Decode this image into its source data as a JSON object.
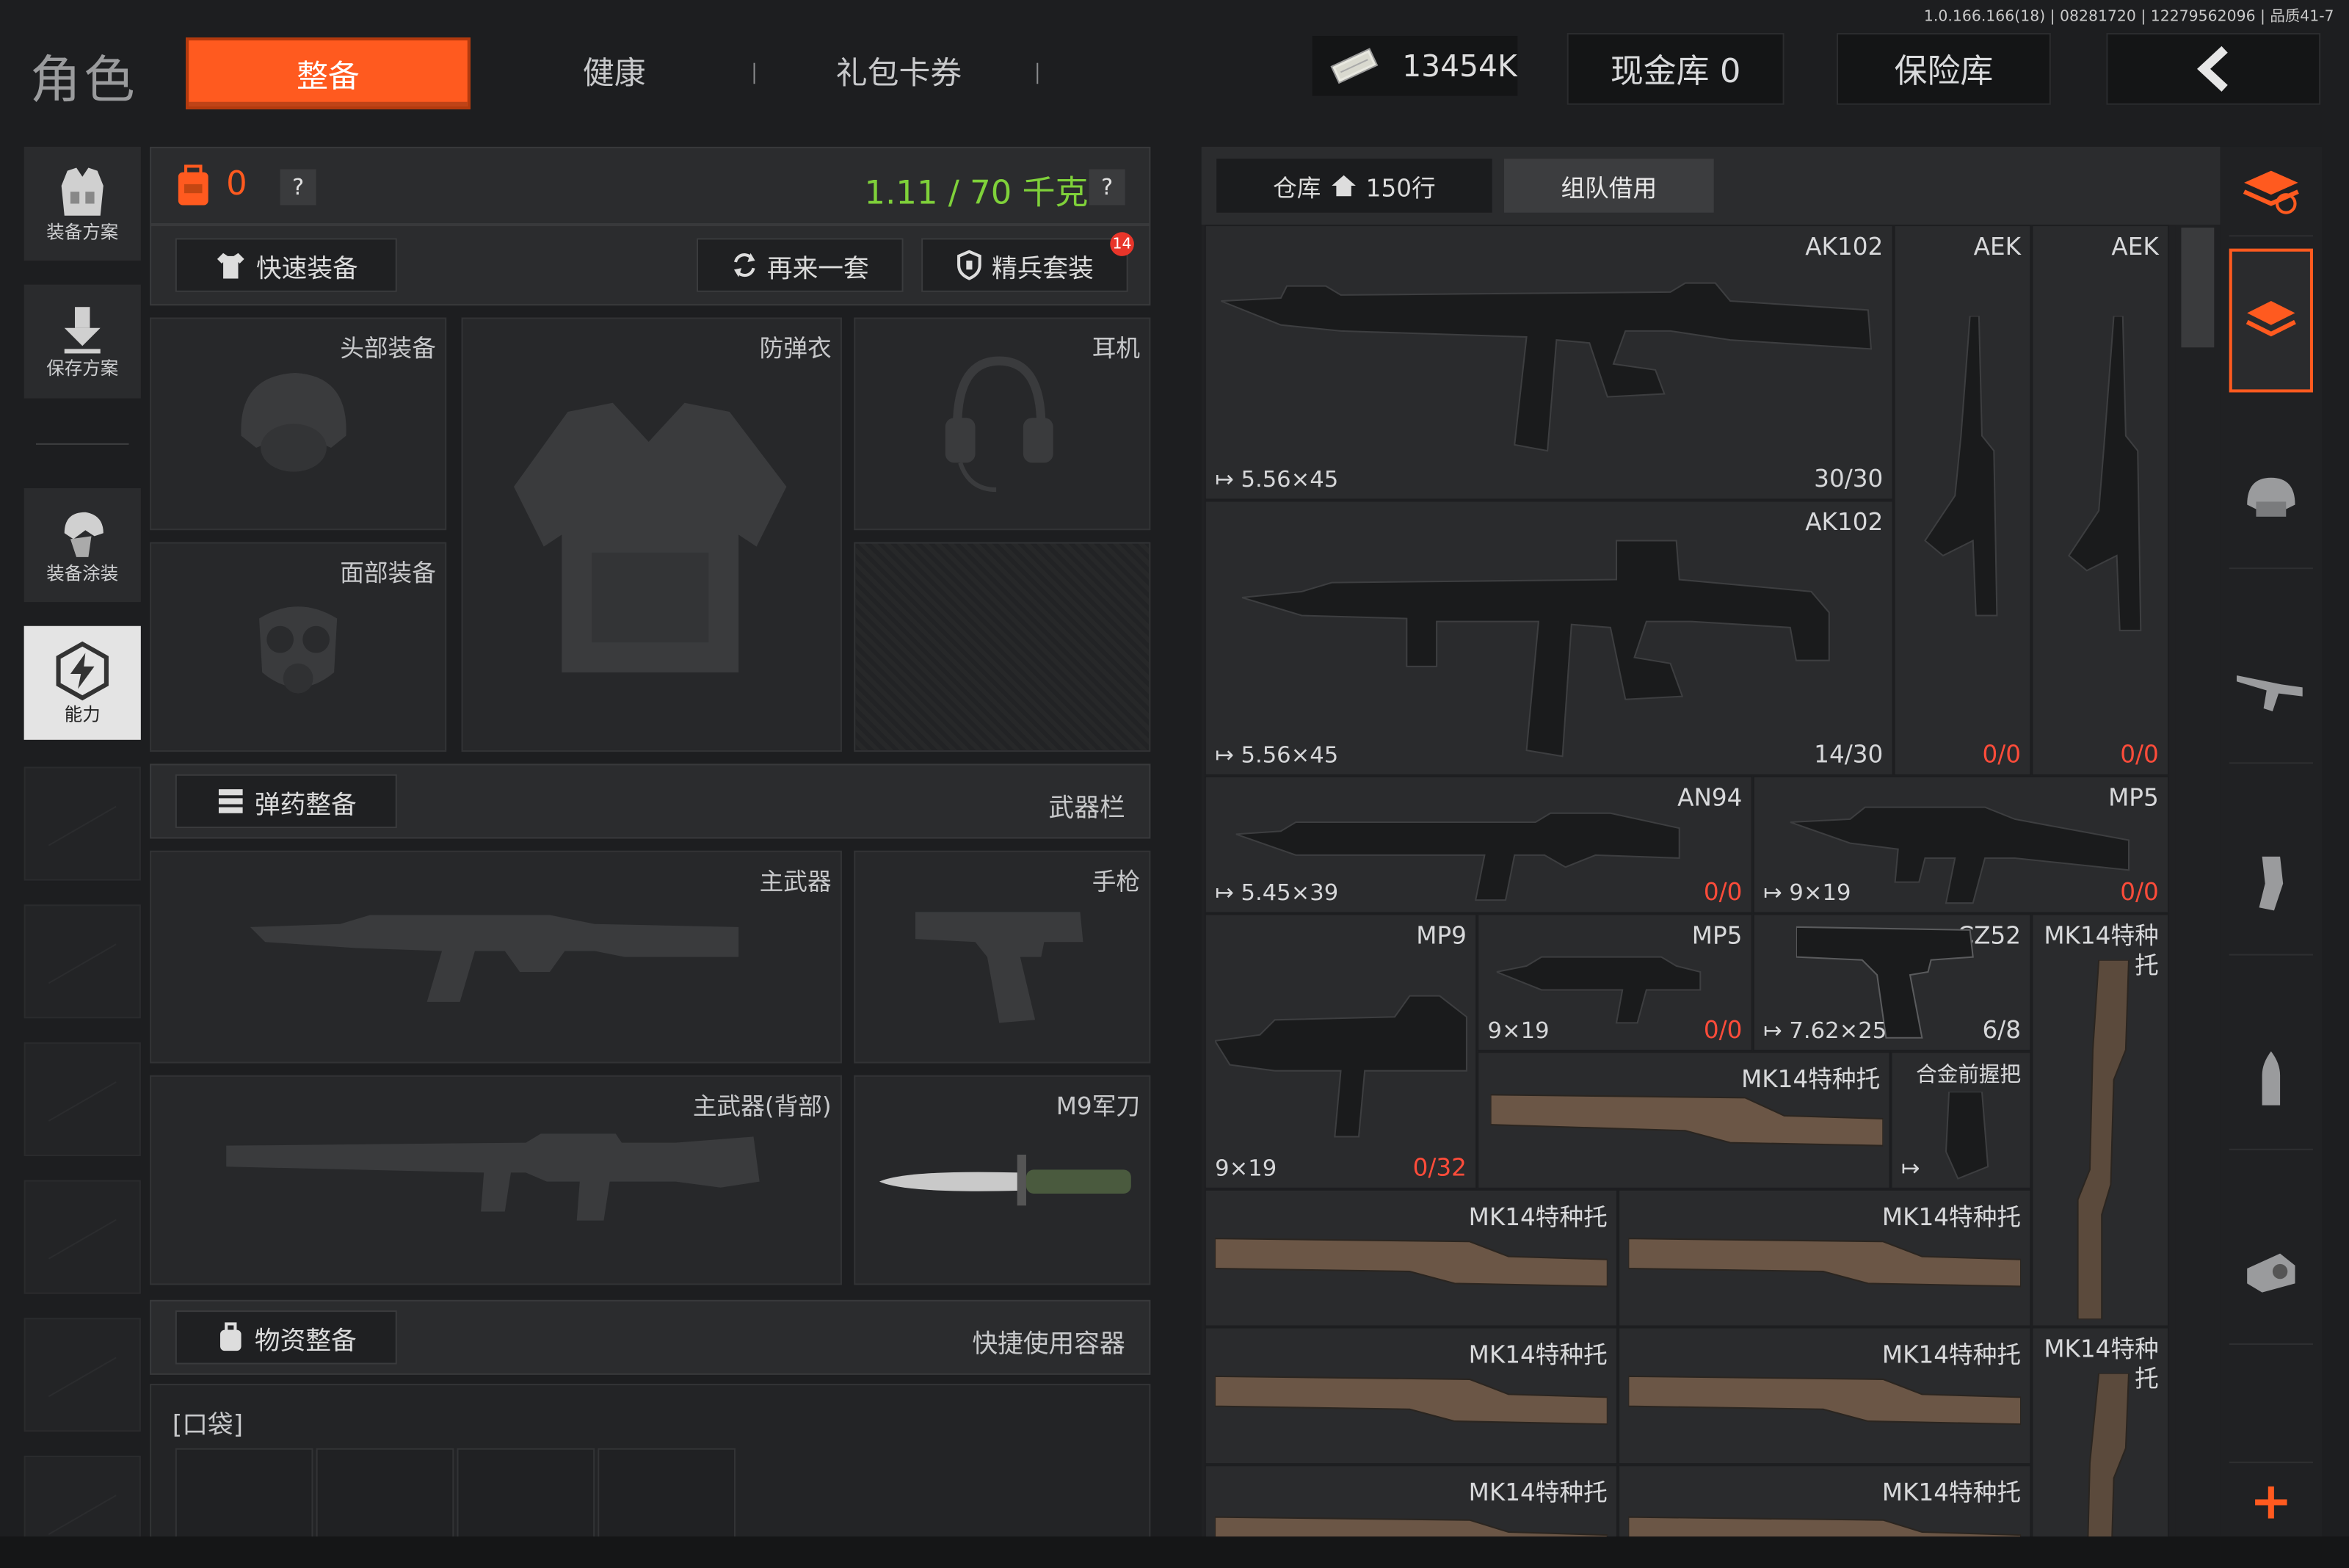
{
  "version": "1.0.166.166(18) | 08281720 | 12279562096 | 品质41-7",
  "header": {
    "title": "角色",
    "tabs": [
      {
        "label": "整备",
        "active": true
      },
      {
        "label": "健康",
        "active": false
      },
      {
        "label": "礼包卡券",
        "active": false
      }
    ],
    "money": "13454K",
    "cash_vault": "现金库 0",
    "safe_box": "保险库"
  },
  "sidebar": {
    "items": [
      {
        "label": "装备方案",
        "icon": "vest-icon"
      },
      {
        "label": "保存方案",
        "icon": "download-icon"
      },
      {
        "label": "装备涂装",
        "icon": "paint-icon"
      },
      {
        "label": "能力",
        "icon": "bolt-icon",
        "active": true
      }
    ]
  },
  "equip": {
    "bag_count": "0",
    "help": "?",
    "weight": "1.11 / 70 千克",
    "quick_equip": "快速装备",
    "again": "再来一套",
    "elite_set": "精兵套装",
    "elite_badge": "14",
    "slots": {
      "head": "头部装备",
      "armor": "防弹衣",
      "ear": "耳机",
      "face": "面部装备",
      "primary": "主武器",
      "pistol": "手枪",
      "primary_back": "主武器(背部)",
      "melee": "M9军刀"
    },
    "ammo_section": "弹药整备",
    "weapon_bar": "武器栏",
    "supply_section": "物资整备",
    "quick_container": "快捷使用容器",
    "pocket": "[口袋]"
  },
  "warehouse": {
    "tab_storage": "仓库",
    "tab_rows": "150行",
    "tab_team": "组队借用",
    "items": [
      {
        "name": "AK102",
        "ammo": "5.56×45",
        "count": "30/30",
        "zero": false
      },
      {
        "name": "AEK",
        "ammo": "",
        "count": "0/0",
        "zero": true
      },
      {
        "name": "AEK",
        "ammo": "",
        "count": "0/0",
        "zero": true
      },
      {
        "name": "AK102",
        "ammo": "5.56×45",
        "count": "14/30",
        "zero": false
      },
      {
        "name": "AN94",
        "ammo": "5.45×39",
        "count": "0/0",
        "zero": true
      },
      {
        "name": "MP5",
        "ammo": "9×19",
        "count": "0/0",
        "zero": true
      },
      {
        "name": "MP9",
        "ammo": "9×19",
        "count": "0/32",
        "zero": true
      },
      {
        "name": "MP5",
        "ammo": "9×19",
        "count": "0/0",
        "zero": true
      },
      {
        "name": "CZ52",
        "ammo": "7.62×25",
        "count": "6/8",
        "zero": false
      },
      {
        "name": "MK14特种托",
        "ammo": "",
        "count": "",
        "zero": false
      },
      {
        "name": "MK14特种托",
        "ammo": "",
        "count": "",
        "zero": false
      },
      {
        "name": "合金前握把",
        "ammo": "",
        "count": "",
        "zero": false
      },
      {
        "name": "MK14特种托",
        "ammo": "",
        "count": "",
        "zero": false
      },
      {
        "name": "MK14特种托",
        "ammo": "",
        "count": "",
        "zero": false
      },
      {
        "name": "MK14特种托",
        "ammo": "",
        "count": "",
        "zero": false
      },
      {
        "name": "MK14特种托",
        "ammo": "",
        "count": "",
        "zero": false
      },
      {
        "name": "MK14特种托",
        "ammo": "",
        "count": "",
        "zero": false
      },
      {
        "name": "MK14特种托",
        "ammo": "",
        "count": "",
        "zero": false
      },
      {
        "name": "MK14特种托",
        "ammo": "",
        "count": "",
        "zero": false
      }
    ]
  },
  "right_filters": [
    "all-items-icon",
    "stack-icon",
    "helmet-icon",
    "rifle-icon",
    "magazine-icon",
    "bullet-icon",
    "sight-icon"
  ],
  "add_label": "+",
  "colors": {
    "accent": "#ff5a1f",
    "weight_green": "#7fd13a",
    "zero_red": "#ff4c3a"
  }
}
